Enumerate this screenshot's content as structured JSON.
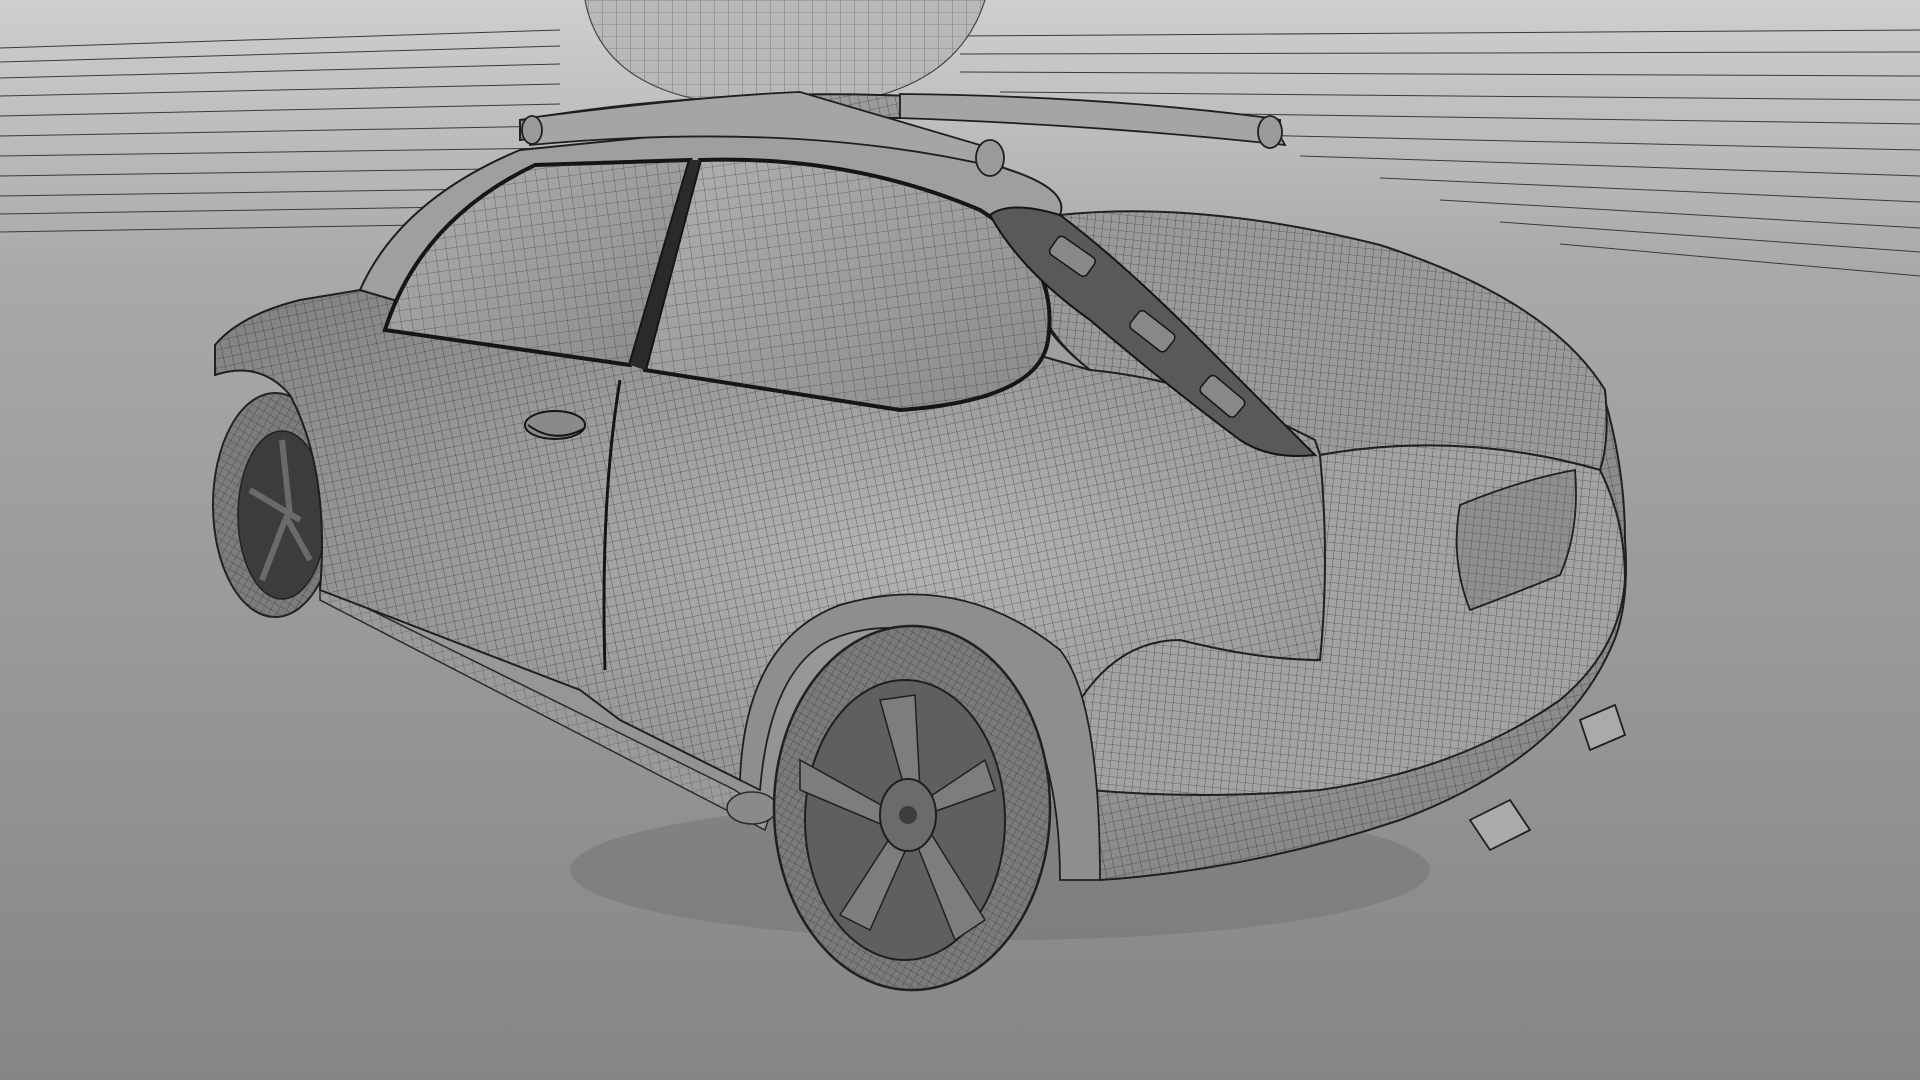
{
  "scene": {
    "subject": "car-wireframe-render",
    "colors": {
      "background_top": "#c8c8c8",
      "background_floor": "#8b8b8b",
      "body_fill": "#a6a6a6",
      "body_shadow": "#7e7e7e",
      "glass_fill": "#9c9c9c",
      "wire_line": "#2a2a2a",
      "tire_fill": "#7c7c7c",
      "rim_fill": "#555555"
    }
  }
}
